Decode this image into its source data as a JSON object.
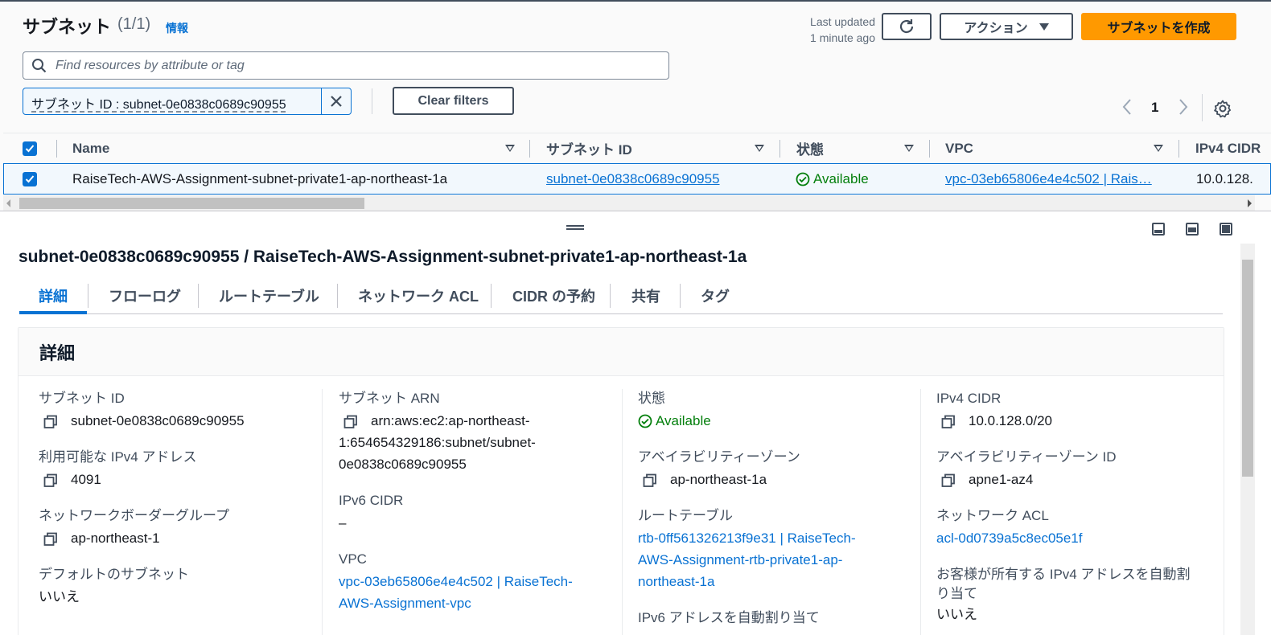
{
  "header": {
    "title": "サブネット",
    "count": "(1/1)",
    "info_link": "情報",
    "last_updated_line1": "Last updated",
    "last_updated_line2": "1 minute ago",
    "actions_label": "アクション",
    "create_label": "サブネットを作成"
  },
  "search": {
    "placeholder": "Find resources by attribute or tag"
  },
  "filter": {
    "token": "サブネット ID : subnet-0e0838c0689c90955",
    "clear_label": "Clear filters"
  },
  "pagination": {
    "current": "1"
  },
  "table": {
    "columns": [
      "Name",
      "サブネット ID",
      "状態",
      "VPC",
      "IPv4 CIDR"
    ],
    "rows": [
      {
        "name": "RaiseTech-AWS-Assignment-subnet-private1-ap-northeast-1a",
        "subnet_id": "subnet-0e0838c0689c90955",
        "state": "Available",
        "vpc": "vpc-03eb65806e4e4c502 | Rais…",
        "ipv4": "10.0.128."
      }
    ]
  },
  "detail": {
    "title": "subnet-0e0838c0689c90955 / RaiseTech-AWS-Assignment-subnet-private1-ap-northeast-1a",
    "tabs": [
      "詳細",
      "フローログ",
      "ルートテーブル",
      "ネットワーク ACL",
      "CIDR の予約",
      "共有",
      "タグ"
    ],
    "section_title": "詳細",
    "col1": {
      "subnet_id_label": "サブネット ID",
      "subnet_id": "subnet-0e0838c0689c90955",
      "available_ipv4_label": "利用可能な IPv4 アドレス",
      "available_ipv4": "4091",
      "nbg_label": "ネットワークボーダーグループ",
      "nbg": "ap-northeast-1",
      "default_subnet_label": "デフォルトのサブネット",
      "default_subnet": "いいえ"
    },
    "col2": {
      "arn_label": "サブネット ARN",
      "arn": "arn:aws:ec2:ap-northeast-1:654654329186:subnet/subnet-0e0838c0689c90955",
      "arn_line1": "arn:aws:ec2:ap-northeast-",
      "arn_line2": "1:654654329186:subnet/subnet-",
      "arn_line3": "0e0838c0689c90955",
      "ipv6_label": "IPv6 CIDR",
      "ipv6": "–",
      "vpc_label": "VPC",
      "vpc_line1": "vpc-03eb65806e4e4c502 | RaiseTech-",
      "vpc_line2": "AWS-Assignment-vpc"
    },
    "col3": {
      "state_label": "状態",
      "state": "Available",
      "az_label": "アベイラビリティーゾーン",
      "az": "ap-northeast-1a",
      "rt_label": "ルートテーブル",
      "rt_line1": "rtb-0ff561326213f9e31 | RaiseTech-",
      "rt_line2": "AWS-Assignment-rtb-private1-ap-",
      "rt_line3": "northeast-1a",
      "ipv6_auto_label": "IPv6 アドレスを自動割り当て"
    },
    "col4": {
      "ipv4_label": "IPv4 CIDR",
      "ipv4": "10.0.128.0/20",
      "az_id_label": "アベイラビリティーゾーン ID",
      "az_id": "apne1-az4",
      "acl_label": "ネットワーク ACL",
      "acl": "acl-0d0739a5c8ec05e1f",
      "owned_ipv4_label_line1": "お客様が所有する IPv4 アドレスを自動割",
      "owned_ipv4_label_line2": "り当て",
      "owned_ipv4": "いいえ"
    }
  },
  "colors": {
    "accent": "#0972d3",
    "primary": "#ff9900",
    "success": "#037f0c"
  },
  "icons": [
    "refresh-icon",
    "caret-down-icon",
    "search-icon",
    "close-icon",
    "chevron-left-icon",
    "chevron-right-icon",
    "gear-icon",
    "check-icon",
    "status-ok-icon",
    "copy-icon"
  ]
}
